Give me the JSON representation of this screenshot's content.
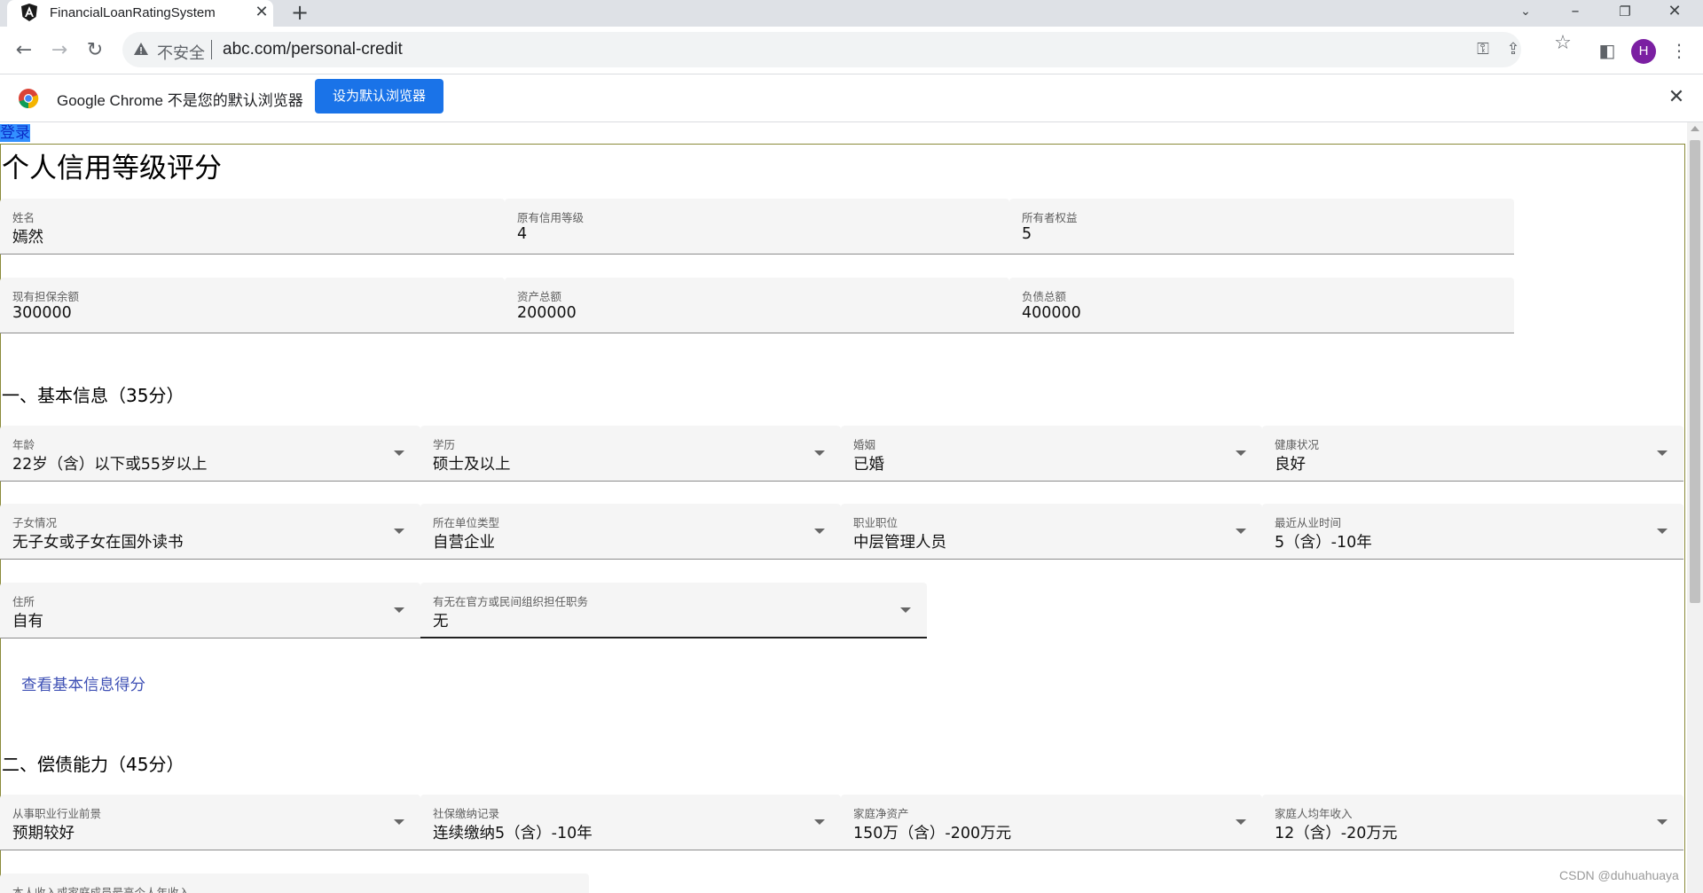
{
  "browser": {
    "tab_title": "FinancialLoanRatingSystem",
    "insecure_label": "不安全",
    "url": "abc.com/personal-credit",
    "avatar_letter": "H",
    "infobar_text": "Google Chrome 不是您的默认浏览器",
    "infobar_button": "设为默认浏览器"
  },
  "page": {
    "login_link": "登录",
    "title": "个人信用等级评分",
    "top_fields": [
      {
        "label": "姓名",
        "value": "嫣然"
      },
      {
        "label": "原有信用等级",
        "value": "4"
      },
      {
        "label": "所有者权益",
        "value": "5"
      },
      {
        "label": "现有担保余额",
        "value": "300000"
      },
      {
        "label": "资产总额",
        "value": "200000"
      },
      {
        "label": "负债总额",
        "value": "400000"
      }
    ],
    "section1": {
      "title": "一、基本信息（35分）",
      "fields": [
        {
          "label": "年龄",
          "value": "22岁（含）以下或55岁以上"
        },
        {
          "label": "学历",
          "value": "硕士及以上"
        },
        {
          "label": "婚姻",
          "value": "已婚"
        },
        {
          "label": "健康状况",
          "value": "良好"
        },
        {
          "label": "子女情况",
          "value": "无子女或子女在国外读书"
        },
        {
          "label": "所在单位类型",
          "value": "自营企业"
        },
        {
          "label": "职业职位",
          "value": "中层管理人员"
        },
        {
          "label": "最近从业时间",
          "value": "5（含）-10年"
        },
        {
          "label": "住所",
          "value": "自有"
        },
        {
          "label": "有无在官方或民间组织担任职务",
          "value": "无"
        }
      ],
      "score_button": "查看基本信息得分"
    },
    "section2": {
      "title": "二、偿债能力（45分）",
      "fields": [
        {
          "label": "从事职业行业前景",
          "value": "预期较好"
        },
        {
          "label": "社保缴纳记录",
          "value": "连续缴纳5（含）-10年"
        },
        {
          "label": "家庭净资产",
          "value": "150万（含）-200万元"
        },
        {
          "label": "家庭人均年收入",
          "value": "12（含）-20万元"
        },
        {
          "label": "本人收入或家庭成员最高个人年收入",
          "value": ""
        }
      ]
    }
  },
  "watermark": "CSDN @duhuahuaya"
}
